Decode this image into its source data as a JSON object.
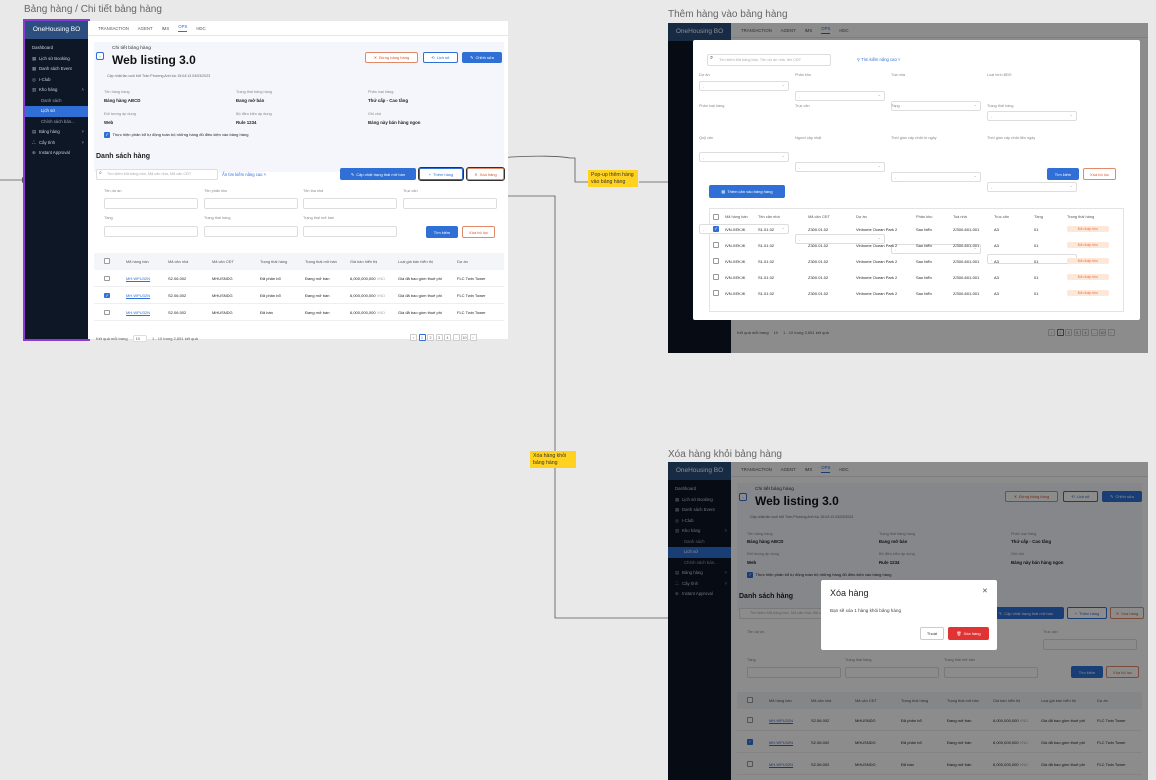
{
  "frames": {
    "left_title": "Bảng hàng / Chi tiết bảng hàng",
    "right_top_title": "Thêm hàng vào bảng hàng",
    "right_bottom_title": "Xóa hàng khỏi bảng hàng"
  },
  "notes": {
    "popup": "Pop-up thêm hàng vào bảng hàng",
    "remove": "Xóa hàng khỏi bảng hàng"
  },
  "sidebar": {
    "logo": "OneHousing BO",
    "items": [
      {
        "label": "Dashboard",
        "icon": ""
      },
      {
        "label": "Lịch sử Booking",
        "icon": "calendar-icon"
      },
      {
        "label": "Danh sách Event",
        "icon": "calendar-icon"
      },
      {
        "label": "I-Club",
        "icon": "club-icon"
      },
      {
        "label": "Kho hàng",
        "icon": "warehouse-icon"
      },
      {
        "label": "Danh sách",
        "icon": ""
      },
      {
        "label": "Lịch sử",
        "icon": ""
      },
      {
        "label": "Chính sách bán...",
        "icon": ""
      },
      {
        "label": "Bảng hàng",
        "icon": "table-icon"
      },
      {
        "label": "Cây tính",
        "icon": "users-icon"
      },
      {
        "label": "Instant Approval",
        "icon": "approval-icon"
      }
    ]
  },
  "topnav": [
    "TRANSACTION",
    "AGENT",
    "IMS",
    "OPS",
    "HDC"
  ],
  "topnav_active": "OPS",
  "detail": {
    "breadcrumb": "Chi tiết bảng hàng",
    "title": "Web listing 3.0",
    "subtitle": "Cập nhật lần cuối bởi Trần Phương Anh lúc 15:04:13 03/03/2023",
    "btn_stop": "Đừng bảng hàng",
    "btn_history": "Lịch sử",
    "btn_edit": "Chỉnh sửa",
    "fields": [
      {
        "label": "Tên bảng hàng",
        "value": "Bảng hàng ABCD"
      },
      {
        "label": "Trạng thái bảng hàng",
        "value": "Đang mở bán"
      },
      {
        "label": "Phân loại hàng",
        "value": "Thứ cấp - Cao tầng"
      },
      {
        "label": "Đối tượng áp dụng",
        "value": "Web"
      },
      {
        "label": "Bộ điều kiện áp dụng",
        "value": "Rule 1234"
      },
      {
        "label": "Ghi chú",
        "value": "Bảng này bán hàng ngon"
      }
    ],
    "auto_check_label": "Thực hiện phân bổ tự động toàn bộ những hàng đủ điều kiện vào bảng hàng"
  },
  "list": {
    "title": "Danh sách hàng",
    "search_placeholder": "Tìm kiếm Mã bảng bán, Mã căn nhà, Mã căn CĐT",
    "advanced": "Ẩn tìm kiếm nâng cao",
    "btn_update": "Cập nhật trạng thái mở bán",
    "btn_add": "Thêm hàng",
    "btn_remove": "Xóa hàng",
    "filter_labels": [
      "Tên dự án",
      "Tên phân khu",
      "Tên tòa nhà",
      "Trục căn",
      "Tầng",
      "Trạng thái hàng",
      "Trạng thái mở bán"
    ],
    "btn_search": "Tìm kiếm",
    "btn_clear": "Xóa bộ lọc",
    "columns": [
      "Mã hàng bán",
      "Mã căn nhà",
      "Mã căn CĐT",
      "Trạng thái hàng",
      "Trạng thái mở bán",
      "Giá bán hiển thị",
      "Loại giá bán hiển thị",
      "Dự án"
    ],
    "rows": [
      {
        "checked": false,
        "code": "MH.WPU32N",
        "unit": "S2.06.002",
        "cdt": "MHUSNDG",
        "status": "Đã phân bổ",
        "sale": "Đang mở bán",
        "price": "6,000,000,000",
        "currency": "VND",
        "price_type": "Giá đã bao gồm thuế phí",
        "project": "FLC Twin Tower"
      },
      {
        "checked": true,
        "code": "MH.WPU32N",
        "unit": "S2.06.002",
        "cdt": "MHUSNDG",
        "status": "Đã phân bổ",
        "sale": "Đang mở bán",
        "price": "6,000,000,000",
        "currency": "VND",
        "price_type": "Giá đã bao gồm thuế phí",
        "project": "FLC Twin Tower"
      },
      {
        "checked": false,
        "code": "MH.WPU32N",
        "unit": "S2.06.002",
        "cdt": "MHUSNDG",
        "status": "Đã bán",
        "sale": "Đang mở bán",
        "price": "6,000,000,000",
        "currency": "VND",
        "price_type": "Giá đã bao gồm thuế phí",
        "project": "FLC Twin Tower"
      }
    ],
    "per_page_label": "Kết quả mỗi trang",
    "per_page": "10",
    "range": "1 - 10 trong 2,651 kết quả",
    "pages": [
      "1",
      "2",
      "3",
      "4",
      "...",
      "10"
    ]
  },
  "add_modal": {
    "search_placeholder": "Tìm kiếm Mã bảng bán, Tên dự án nhà, tên CĐT",
    "advanced": "Tìm kiếm nâng cao",
    "filter_labels": [
      "Dự án",
      "Phân khu",
      "Tòa nhà",
      "Loại hình BĐS",
      "Phân loại hàng",
      "Trục căn",
      "Tầng",
      "Trạng thái hàng",
      "Quỹ căn",
      "Người cập nhật",
      "Thời gian cập nhật từ ngày",
      "Thời gian cập nhật đến ngày"
    ],
    "select_placeholder": "-",
    "btn_search": "Tìm kiếm",
    "btn_clear": "Xóa bộ lọc",
    "btn_add": "Thêm căn vào bảng hàng",
    "columns": [
      "Mã hàng bán",
      "Tên căn nhà",
      "Mã căn CĐT",
      "Dự án",
      "Phân khu",
      "Toà nhà",
      "Trục căn",
      "Tầng",
      "Trạng thái hàng"
    ],
    "rows": [
      {
        "checked": true,
        "code": "IVN.XEKJK",
        "unit": "S1.01.02",
        "cdt": "Z300.01.02",
        "project": "Vinhome Ocean Park 2",
        "zone": "Sao biển",
        "building": "Z/300-601-001",
        "axis": "A3",
        "floor": "01",
        "status": "Đã nhập kho"
      },
      {
        "checked": false,
        "code": "IVN.XEKJK",
        "unit": "S1.01.02",
        "cdt": "Z300.01.02",
        "project": "Vinhome Ocean Park 2",
        "zone": "Sao biển",
        "building": "Z/300-601-001",
        "axis": "A3",
        "floor": "01",
        "status": "Đã nhập kho"
      },
      {
        "checked": false,
        "code": "IVN.XEKJK",
        "unit": "S1.01.02",
        "cdt": "Z300.01.02",
        "project": "Vinhome Ocean Park 2",
        "zone": "Sao biển",
        "building": "Z/300-601-001",
        "axis": "A3",
        "floor": "01",
        "status": "Đã nhập kho"
      },
      {
        "checked": false,
        "code": "IVN.XEKJK",
        "unit": "S1.01.02",
        "cdt": "Z300.01.02",
        "project": "Vinhome Ocean Park 2",
        "zone": "Sao biển",
        "building": "Z/300-601-001",
        "axis": "A3",
        "floor": "01",
        "status": "Đã nhập kho"
      },
      {
        "checked": false,
        "code": "IVN.XEKJK",
        "unit": "S1.01.02",
        "cdt": "Z300.01.02",
        "project": "Vinhome Ocean Park 2",
        "zone": "Sao biển",
        "building": "Z/300-601-001",
        "axis": "A3",
        "floor": "01",
        "status": "Đã nhập kho"
      }
    ]
  },
  "remove_modal": {
    "title": "Xóa hàng",
    "body": "Bạn sẽ xóa 1 hàng khỏi bảng hàng",
    "btn_cancel": "Thoát",
    "btn_confirm": "Xóa hàng"
  }
}
